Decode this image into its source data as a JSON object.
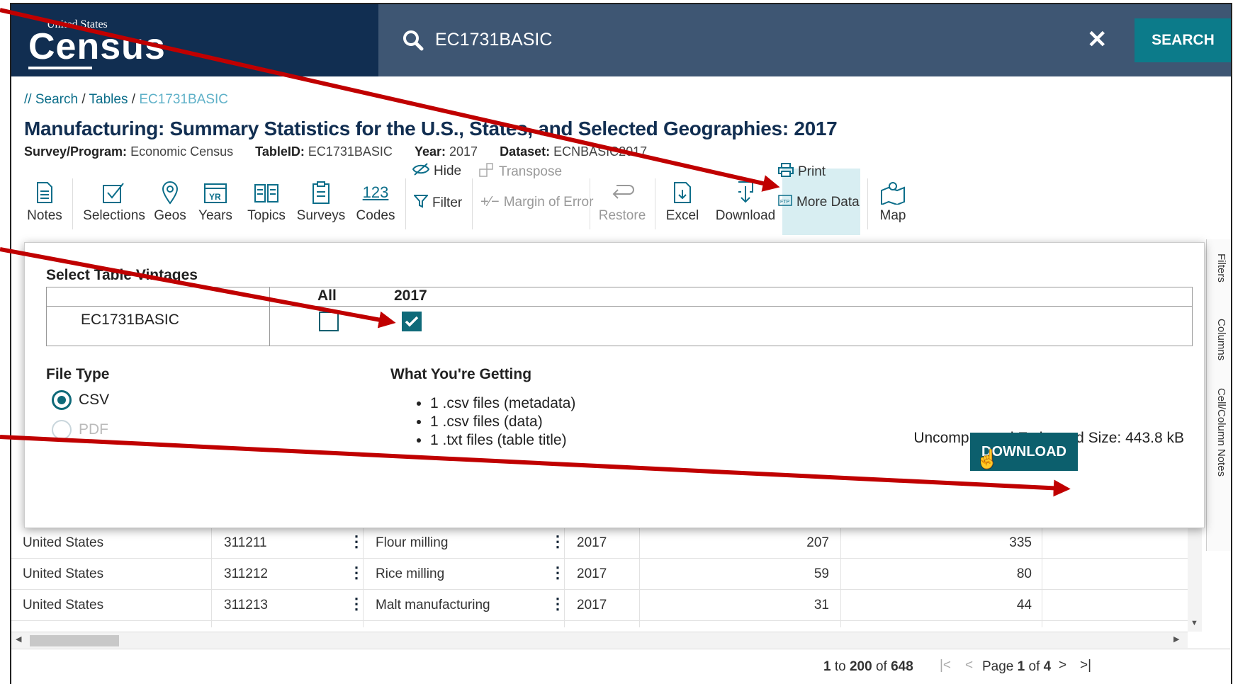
{
  "header": {
    "logo_small": "United States",
    "logo_big": "Census",
    "search_query": "EC1731BASIC",
    "clear_label": "✕",
    "search_button": "SEARCH"
  },
  "breadcrumb": {
    "prefix": "// ",
    "items": [
      "Search",
      "Tables",
      "EC1731BASIC"
    ],
    "separator": " / "
  },
  "table_info": {
    "title": "Manufacturing: Summary Statistics for the U.S., States, and Selected Geographies: 2017",
    "survey_label": "Survey/Program:",
    "survey_value": "Economic Census",
    "tableid_label": "TableID:",
    "tableid_value": "EC1731BASIC",
    "year_label": "Year:",
    "year_value": "2017",
    "dataset_label": "Dataset:",
    "dataset_value": "ECNBASIC2017"
  },
  "toolbar": {
    "notes": "Notes",
    "selections": "Selections",
    "geos": "Geos",
    "years": "Years",
    "topics": "Topics",
    "surveys": "Surveys",
    "codes": "Codes",
    "codes_icon_text": "123",
    "hide": "Hide",
    "filter": "Filter",
    "transpose": "Transpose",
    "margin_of_error": "Margin of Error",
    "restore": "Restore",
    "excel": "Excel",
    "download": "Download",
    "print": "Print",
    "more_data": "More Data",
    "map": "Map"
  },
  "modal": {
    "heading": "Select Table Vintages",
    "col_all": "All",
    "col_2017": "2017",
    "row_name": "EC1731BASIC",
    "all_checked": false,
    "year_checked": true,
    "file_type_heading": "File Type",
    "file_types": [
      "CSV",
      "PDF"
    ],
    "selected_file_type": "CSV",
    "wyg_heading": "What You're Getting",
    "wyg_items": [
      "1 .csv files (metadata)",
      "1 .csv files (data)",
      "1 .txt files (table title)"
    ],
    "size_text": "Uncompressed Estimated Size: 443.8 kB",
    "download_button": "DOWNLOAD"
  },
  "side_tabs": [
    "Filters",
    "Columns",
    "Cell/Column Notes"
  ],
  "rows": [
    {
      "geo": "United States",
      "code": "311211",
      "desc": "Flour milling",
      "year": "2017",
      "v1": "207",
      "v2": "335"
    },
    {
      "geo": "United States",
      "code": "311212",
      "desc": "Rice milling",
      "year": "2017",
      "v1": "59",
      "v2": "80"
    },
    {
      "geo": "United States",
      "code": "311213",
      "desc": "Malt manufacturing",
      "year": "2017",
      "v1": "31",
      "v2": "44"
    }
  ],
  "pagination": {
    "range_start": "1",
    "range_to": " to ",
    "range_end": "200",
    "range_of": " of ",
    "total": "648",
    "page_label": "Page ",
    "page_current": "1",
    "page_of": " of ",
    "page_total": "4"
  },
  "colors": {
    "header_dark": "#112e51",
    "header_search": "#3e5673",
    "accent_teal": "#0c7b8a",
    "arrow_red": "#c00000"
  }
}
